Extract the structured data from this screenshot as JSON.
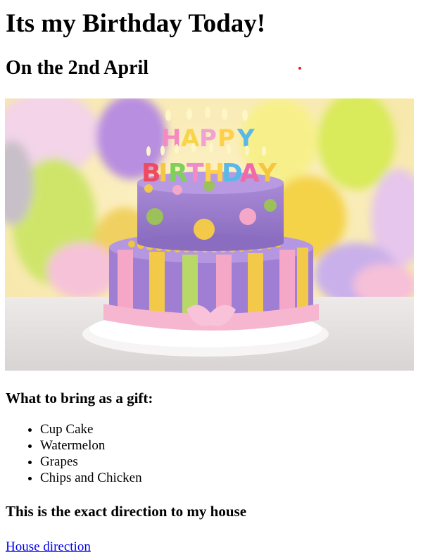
{
  "page": {
    "title": "Its my Birthday Today!",
    "subtitle": "On the 2nd April"
  },
  "hero": {
    "icon": "birthday-cake-photo",
    "cake_text_top": "HAPPY",
    "cake_text_bottom": "BIRTHDAY"
  },
  "gifts": {
    "heading": "What to bring as a gift:",
    "items": [
      "Cup Cake",
      "Watermelon",
      "Grapes",
      "Chips and Chicken"
    ]
  },
  "directions": {
    "heading": "This is the exact direction to my house",
    "link_label": "House direction"
  },
  "colors": {
    "link": "#0000ee",
    "marker": "#e02020"
  }
}
